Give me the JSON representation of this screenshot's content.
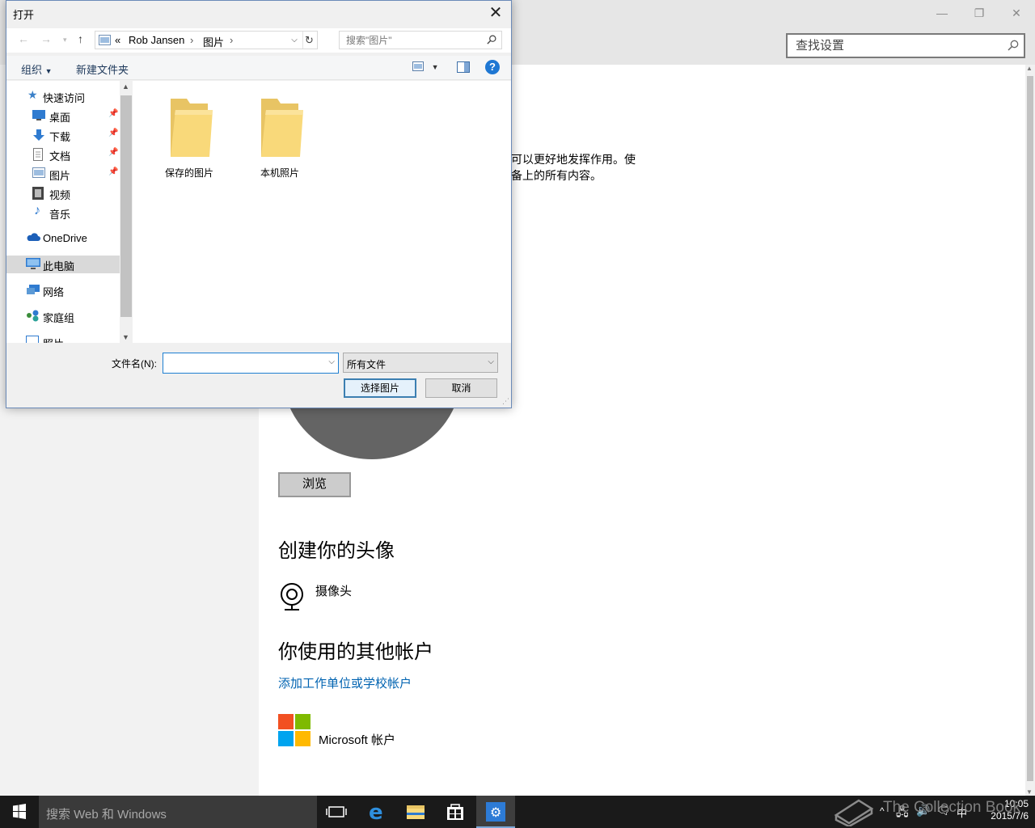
{
  "settings": {
    "search_placeholder": "查找设置",
    "description_line1": "可以更好地发挥作用。使",
    "description_line2": "备上的所有内容。",
    "browse_label": "浏览",
    "create_heading": "创建你的头像",
    "camera_label": "摄像头",
    "other_accounts_heading": "你使用的其他帐户",
    "add_work_link": "添加工作单位或学校帐户",
    "ms_account_label": "Microsoft 帐户",
    "window_controls": [
      "—",
      "❐",
      "✕"
    ]
  },
  "dialog": {
    "title": "打开",
    "address": {
      "prefix": "«",
      "segments": [
        "Rob Jansen",
        "图片"
      ]
    },
    "search_placeholder": "搜索\"图片\"",
    "commands": {
      "organize": "组织",
      "new_folder": "新建文件夹"
    },
    "nav_items": [
      {
        "label": "快速访问",
        "icon": "star-icon"
      },
      {
        "label": "桌面",
        "icon": "desktop-icon"
      },
      {
        "label": "下载",
        "icon": "download-icon"
      },
      {
        "label": "文档",
        "icon": "document-icon"
      },
      {
        "label": "图片",
        "icon": "pictures-icon"
      },
      {
        "label": "视频",
        "icon": "video-icon"
      },
      {
        "label": "音乐",
        "icon": "music-icon"
      },
      {
        "label": "OneDrive",
        "icon": "cloud-icon"
      },
      {
        "label": "此电脑",
        "icon": "computer-icon"
      },
      {
        "label": "网络",
        "icon": "network-icon"
      },
      {
        "label": "家庭组",
        "icon": "homegroup-icon"
      },
      {
        "label": "照片",
        "icon": "photos-icon"
      }
    ],
    "folders": [
      {
        "label": "保存的图片"
      },
      {
        "label": "本机照片"
      }
    ],
    "filename_label": "文件名(N):",
    "filename_value": "",
    "filetype_value": "所有文件",
    "ok_label": "选择图片",
    "cancel_label": "取消"
  },
  "taskbar": {
    "search_text": "搜索 Web 和 Windows",
    "time": "10:05",
    "date": "2015/7/6",
    "ime": "中",
    "watermark": "The Collection Book"
  },
  "colors": {
    "accent": "#0063b1",
    "taskbar": "#1a1a1a",
    "ms_red": "#f25022",
    "ms_green": "#7fba00",
    "ms_blue": "#00a4ef",
    "ms_yellow": "#ffb900"
  }
}
